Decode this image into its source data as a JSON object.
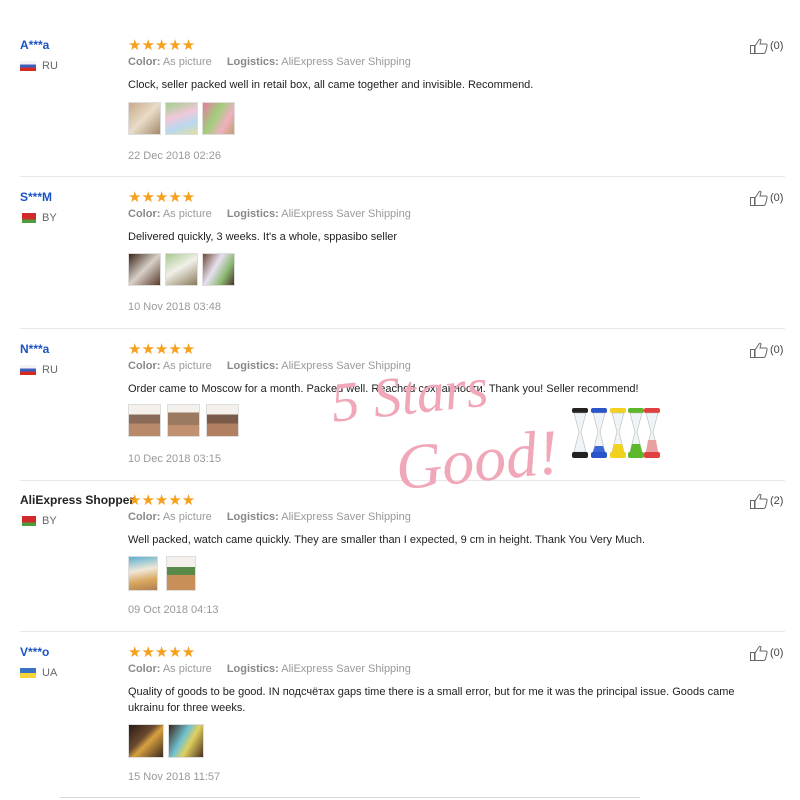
{
  "reviews": [
    {
      "user": "A***a",
      "country": "RU",
      "stars": "★★★★★",
      "color_label": "Color:",
      "color_value": "As picture",
      "logistics_label": "Logistics:",
      "logistics_value": "AliExpress Saver Shipping",
      "text": "Clock, seller packed well in retail box, all came together and invisible. Recommend.",
      "date": "22 Dec 2018 02:26",
      "likes": "(0)"
    },
    {
      "user": "S***M",
      "country": "BY",
      "stars": "★★★★★",
      "color_label": "Color:",
      "color_value": "As picture",
      "logistics_label": "Logistics:",
      "logistics_value": "AliExpress Saver Shipping",
      "text": "Delivered quickly, 3 weeks. It's a whole, sppasibo seller",
      "date": "10 Nov 2018 03:48",
      "likes": "(0)"
    },
    {
      "user": "N***a",
      "country": "RU",
      "stars": "★★★★★",
      "color_label": "Color:",
      "color_value": "As picture",
      "logistics_label": "Logistics:",
      "logistics_value": "AliExpress Saver Shipping",
      "text": "Order came to Moscow for a month. Packed well. Reached сохранности. Thank you! Seller recommend!",
      "date": "10 Dec 2018 03:15",
      "likes": "(0)"
    },
    {
      "user": "AliExpress Shopper",
      "country": "BY",
      "stars": "★★★★★",
      "color_label": "Color:",
      "color_value": "As picture",
      "logistics_label": "Logistics:",
      "logistics_value": "AliExpress Saver Shipping",
      "text": "Well packed, watch came quickly. They are smaller than I expected, 9 cm in height. Thank You Very Much.",
      "date": "09 Oct 2018 04:13",
      "likes": "(2)"
    },
    {
      "user": "V***o",
      "country": "UA",
      "stars": "★★★★★",
      "color_label": "Color:",
      "color_value": "As picture",
      "logistics_label": "Logistics:",
      "logistics_value": "AliExpress Saver Shipping",
      "text": "Quality of goods to be good. IN подсчётах gaps time there is a small error, but for me it was the principal issue. Goods came ukrainu for three weeks.",
      "date": "15 Nov 2018 11:57",
      "likes": "(0)"
    }
  ],
  "overlay": {
    "line1": "5 Stars",
    "line2": "Good!"
  },
  "colors": {
    "username": "#1a52c4",
    "star": "#f7a01d",
    "overlay_text": "#f0a8b8"
  }
}
